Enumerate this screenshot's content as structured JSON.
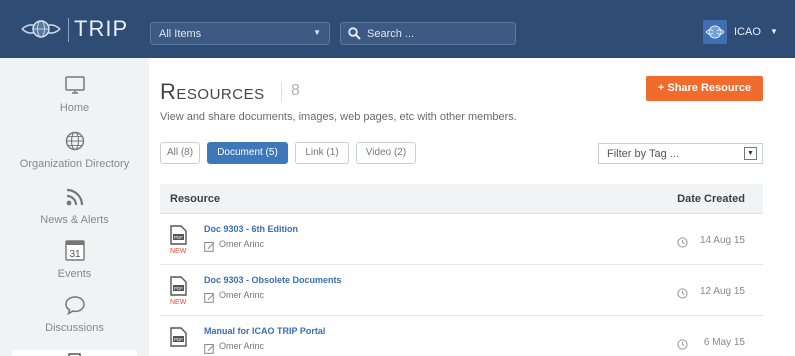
{
  "app": {
    "logo_text": "TRIP",
    "logo_icon": "icao-emblem-icon"
  },
  "header": {
    "scope_select": "All Items",
    "search_placeholder": "Search ...",
    "user_name": "ICAO",
    "colors": {
      "bar": "#2f4d74",
      "accent": "#f06b2c",
      "active_tab": "#3f78b8"
    }
  },
  "sidebar": {
    "items": [
      {
        "label": "Home",
        "icon": "monitor-icon"
      },
      {
        "label": "Organization Directory",
        "icon": "globe-icon"
      },
      {
        "label": "News & Alerts",
        "icon": "rss-icon"
      },
      {
        "label": "Events",
        "icon": "calendar-icon",
        "calendar_day": "31"
      },
      {
        "label": "Discussions",
        "icon": "speech-bubble-icon"
      }
    ]
  },
  "main": {
    "title": "Resources",
    "count": "8",
    "description": "View and share documents, images, web pages, etc with other members.",
    "share_button": "+ Share Resource",
    "tabs": [
      {
        "label": "All (8)",
        "active": false
      },
      {
        "label": "Document (5)",
        "active": true
      },
      {
        "label": "Link (1)",
        "active": false
      },
      {
        "label": "Video (2)",
        "active": false
      }
    ],
    "filter_placeholder": "Filter by Tag ...",
    "table": {
      "headers": {
        "resource": "Resource",
        "date": "Date Created"
      },
      "rows": [
        {
          "title": "Doc 9303 - 6th Edition",
          "author": "Omer Arinc",
          "date": "14 Aug 15",
          "new_label": "NEW",
          "icon": "pdf-file-icon"
        },
        {
          "title": "Doc 9303 - Obsolete Documents",
          "author": "Omer Arinc",
          "date": "12 Aug 15",
          "new_label": "NEW",
          "icon": "pdf-file-icon"
        },
        {
          "title": "Manual for ICAO TRIP Portal",
          "author": "Omer Arinc",
          "date": "6 May 15",
          "new_label": "",
          "icon": "pdf-file-icon"
        }
      ]
    }
  }
}
